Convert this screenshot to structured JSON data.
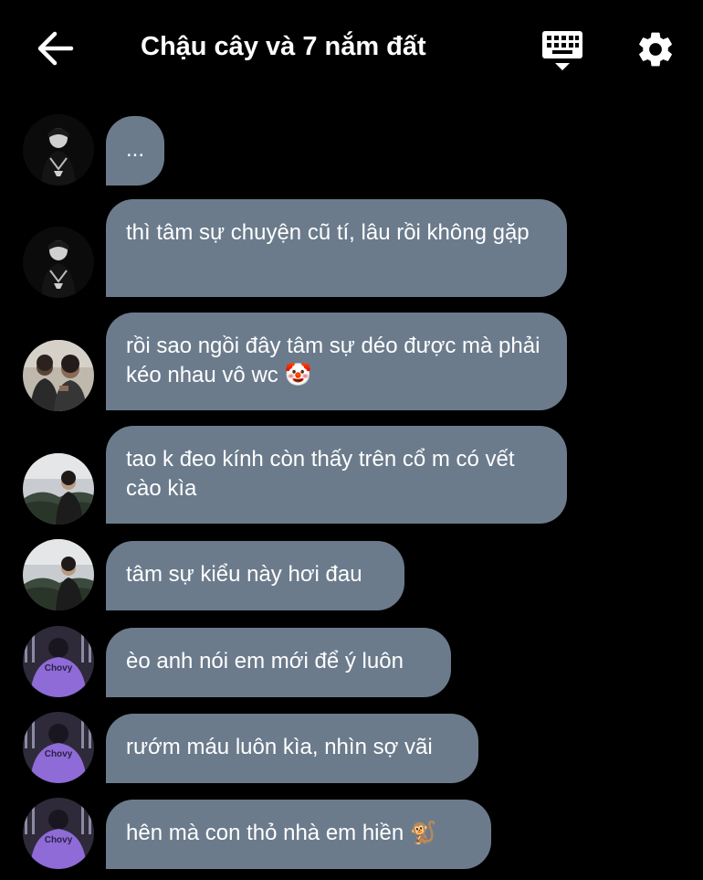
{
  "header": {
    "title": "Chậu cây và 7 nắm đất",
    "back_icon": "arrow-left-icon",
    "keyboard_icon": "keyboard-icon",
    "settings_icon": "gear-icon"
  },
  "colors": {
    "background": "#000000",
    "bubble": "#6b7b8c",
    "text": "#ffffff"
  },
  "messages": [
    {
      "text": "...",
      "avatar": "avatar-dark-hood"
    },
    {
      "text": "thì tâm sự chuyện cũ tí, lâu rồi không gặp",
      "avatar": "avatar-dark-hood"
    },
    {
      "text": "rồi sao ngồi đây tâm sự déo được mà phải kéo nhau vô wc 🤡",
      "avatar": "avatar-two-guys"
    },
    {
      "text": "tao k đeo kính còn thấy trên cổ m có vết cào kìa",
      "avatar": "avatar-outdoor"
    },
    {
      "text": "tâm sự kiểu này hơi đau",
      "avatar": "avatar-outdoor"
    },
    {
      "text": "èo anh nói em mới để ý luôn",
      "avatar": "avatar-chovy"
    },
    {
      "text": "rướm máu luôn kìa, nhìn sợ vãi",
      "avatar": "avatar-chovy"
    },
    {
      "text": "hên mà con thỏ nhà em hiền 🐒",
      "avatar": "avatar-chovy"
    }
  ],
  "avatar_labels": {
    "chovy": "Chovy"
  }
}
